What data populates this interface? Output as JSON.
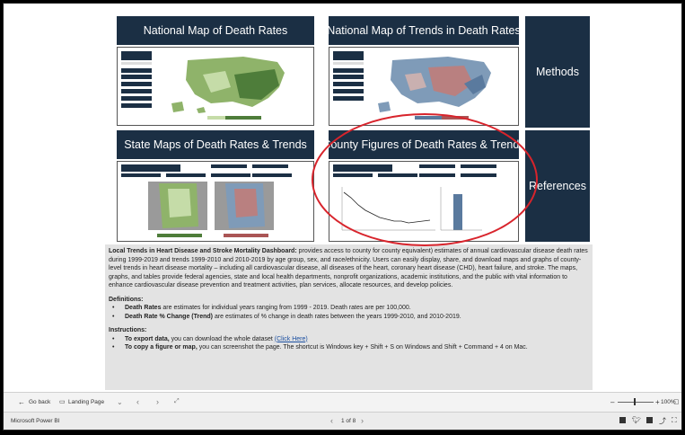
{
  "tiles": {
    "national_map": "National Map of Death Rates",
    "national_trends": "National Map of Trends in Death Rates",
    "state_maps": "State Maps of Death Rates & Trends",
    "county_figures": "County Figures of Death Rates & Trends",
    "methods": "Methods",
    "references": "References"
  },
  "description": {
    "lead_bold": "Local Trends in Heart Disease and Stroke Mortality Dashboard:",
    "lead_text": " provides access to county for county equivalent) estimates of annual cardiovascular disease death rates during 1999-2019 and trends 1999-2010 and 2010-2019 by age group, sex, and race/ethnicity. Users can easily display, share, and download maps and graphs of county-level trends in heart disease mortality – including all cardiovascular disease, all diseases of the heart, coronary heart disease (CHD), heart failure, and stroke. The maps, graphs, and tables provide federal agencies, state and local health departments, nonprofit organizations, academic institutions, and the public with vital information to enhance cardiovascular disease prevention and treatment activities, plan services, allocate resources, and develop policies.",
    "definitions_title": "Definitions:",
    "def1_bold": "Death Rates",
    "def1_text": " are estimates for individual years ranging from 1999 - 2019. Death rates are per 100,000.",
    "def2_bold": "Death Rate % Change (Trend)",
    "def2_text": " are estimates of % change in death rates between the years 1999-2010, and 2010-2019.",
    "instructions_title": "Instructions:",
    "ins1_bold": "To export data,",
    "ins1_text": " you can download the whole dataset ",
    "ins1_link": "(Click Here)",
    "ins2_bold": "To copy a figure or map,",
    "ins2_text": " you can screenshot the page. The shortcut is Windows key + Shift + S on Windows and Shift + Command + 4 on Mac."
  },
  "nav": {
    "go_back": "Go back",
    "landing_page": "Landing Page",
    "zoom_level": "100%"
  },
  "status": {
    "app_name": "Microsoft Power BI",
    "page_indicator": "1 of 8"
  },
  "colors": {
    "tile_bg": "#1b2f44",
    "annotation": "#d8242c"
  }
}
